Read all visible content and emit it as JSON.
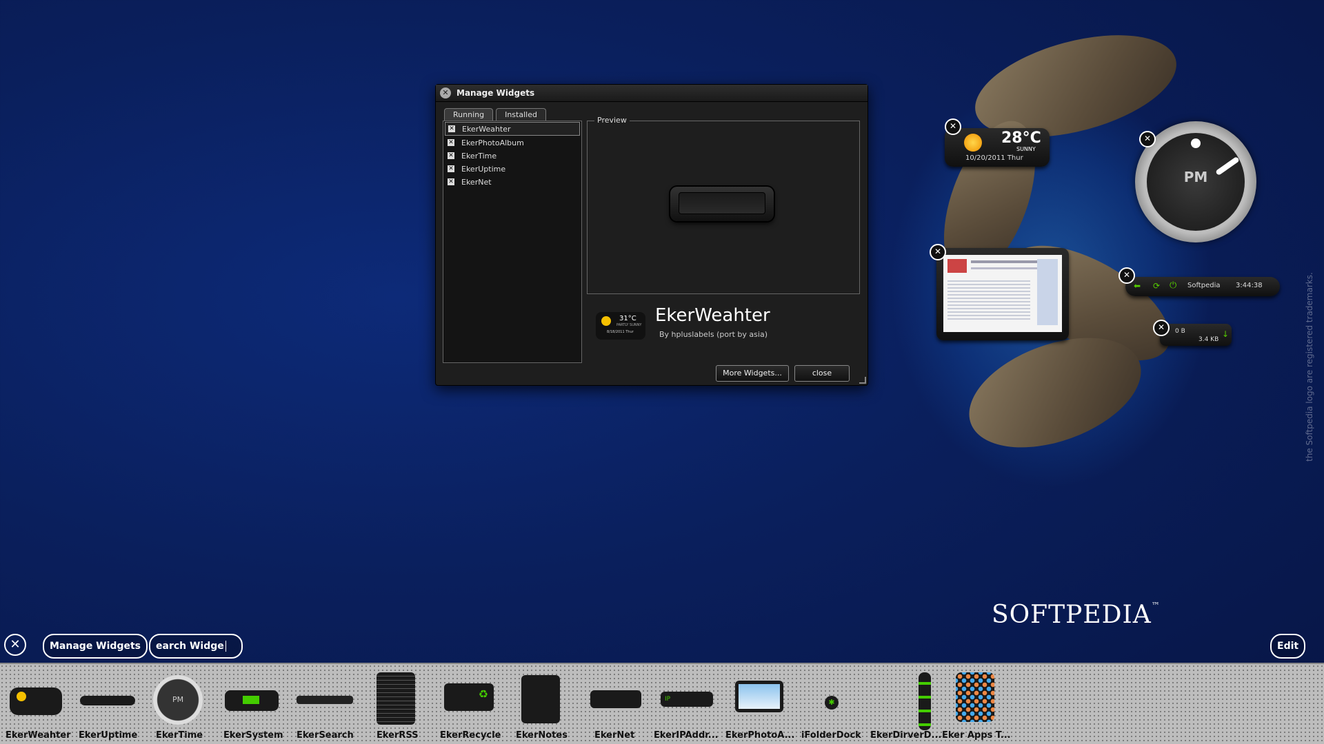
{
  "dialog": {
    "title": "Manage Widgets",
    "tabs": [
      "Running",
      "Installed"
    ],
    "running_list": [
      "EkerWeahter",
      "EkerPhotoAlbum",
      "EkerTime",
      "EkerUptime",
      "EkerNet"
    ],
    "preview_label": "Preview",
    "selected_name": "EkerWeahter",
    "selected_author": "By hpluslabels (port by asia)",
    "icon_temp": "31°C",
    "icon_cond": "PARTLY SUNNY",
    "icon_date": "8/18/2011 Thur",
    "more_button": "More Widgets...",
    "close_button": "close"
  },
  "desktop_widgets": {
    "weather_temp": "28°C",
    "weather_cond": "SUNNY",
    "weather_date": "10/20/2011 Thur",
    "clock_label": "PM",
    "uptime_name": "Softpedia",
    "uptime_time": "3:44:38",
    "net_up": "0 B",
    "net_down": "3.4 KB"
  },
  "toolbar": {
    "manage_button": "Manage Widgets",
    "search_value": "earch Widge",
    "edit_button": "Edit"
  },
  "dock": [
    {
      "label": "EkerWeahter",
      "icon": "weather-widget-icon"
    },
    {
      "label": "EkerUptime",
      "icon": "uptime-widget-icon"
    },
    {
      "label": "EkerTime",
      "icon": "clock-widget-icon"
    },
    {
      "label": "EkerSystem",
      "icon": "system-widget-icon"
    },
    {
      "label": "EkerSearch",
      "icon": "search-widget-icon"
    },
    {
      "label": "EkerRSS",
      "icon": "rss-widget-icon"
    },
    {
      "label": "EkerRecycle",
      "icon": "recycle-widget-icon"
    },
    {
      "label": "EkerNotes",
      "icon": "notes-widget-icon"
    },
    {
      "label": "EkerNet",
      "icon": "net-widget-icon"
    },
    {
      "label": "EkerIPAddr...",
      "icon": "ip-widget-icon"
    },
    {
      "label": "EkerPhotoA...",
      "icon": "photo-widget-icon"
    },
    {
      "label": "iFolderDock",
      "icon": "folder-dock-icon"
    },
    {
      "label": "EkerDirverD...",
      "icon": "driver-widget-icon"
    },
    {
      "label": "Eker Apps T...",
      "icon": "apps-widget-icon"
    }
  ],
  "branding": {
    "softpedia": "SOFTPEDIA",
    "tm": "™",
    "trademark_text": "the Softpedia logo are registered trademarks."
  }
}
